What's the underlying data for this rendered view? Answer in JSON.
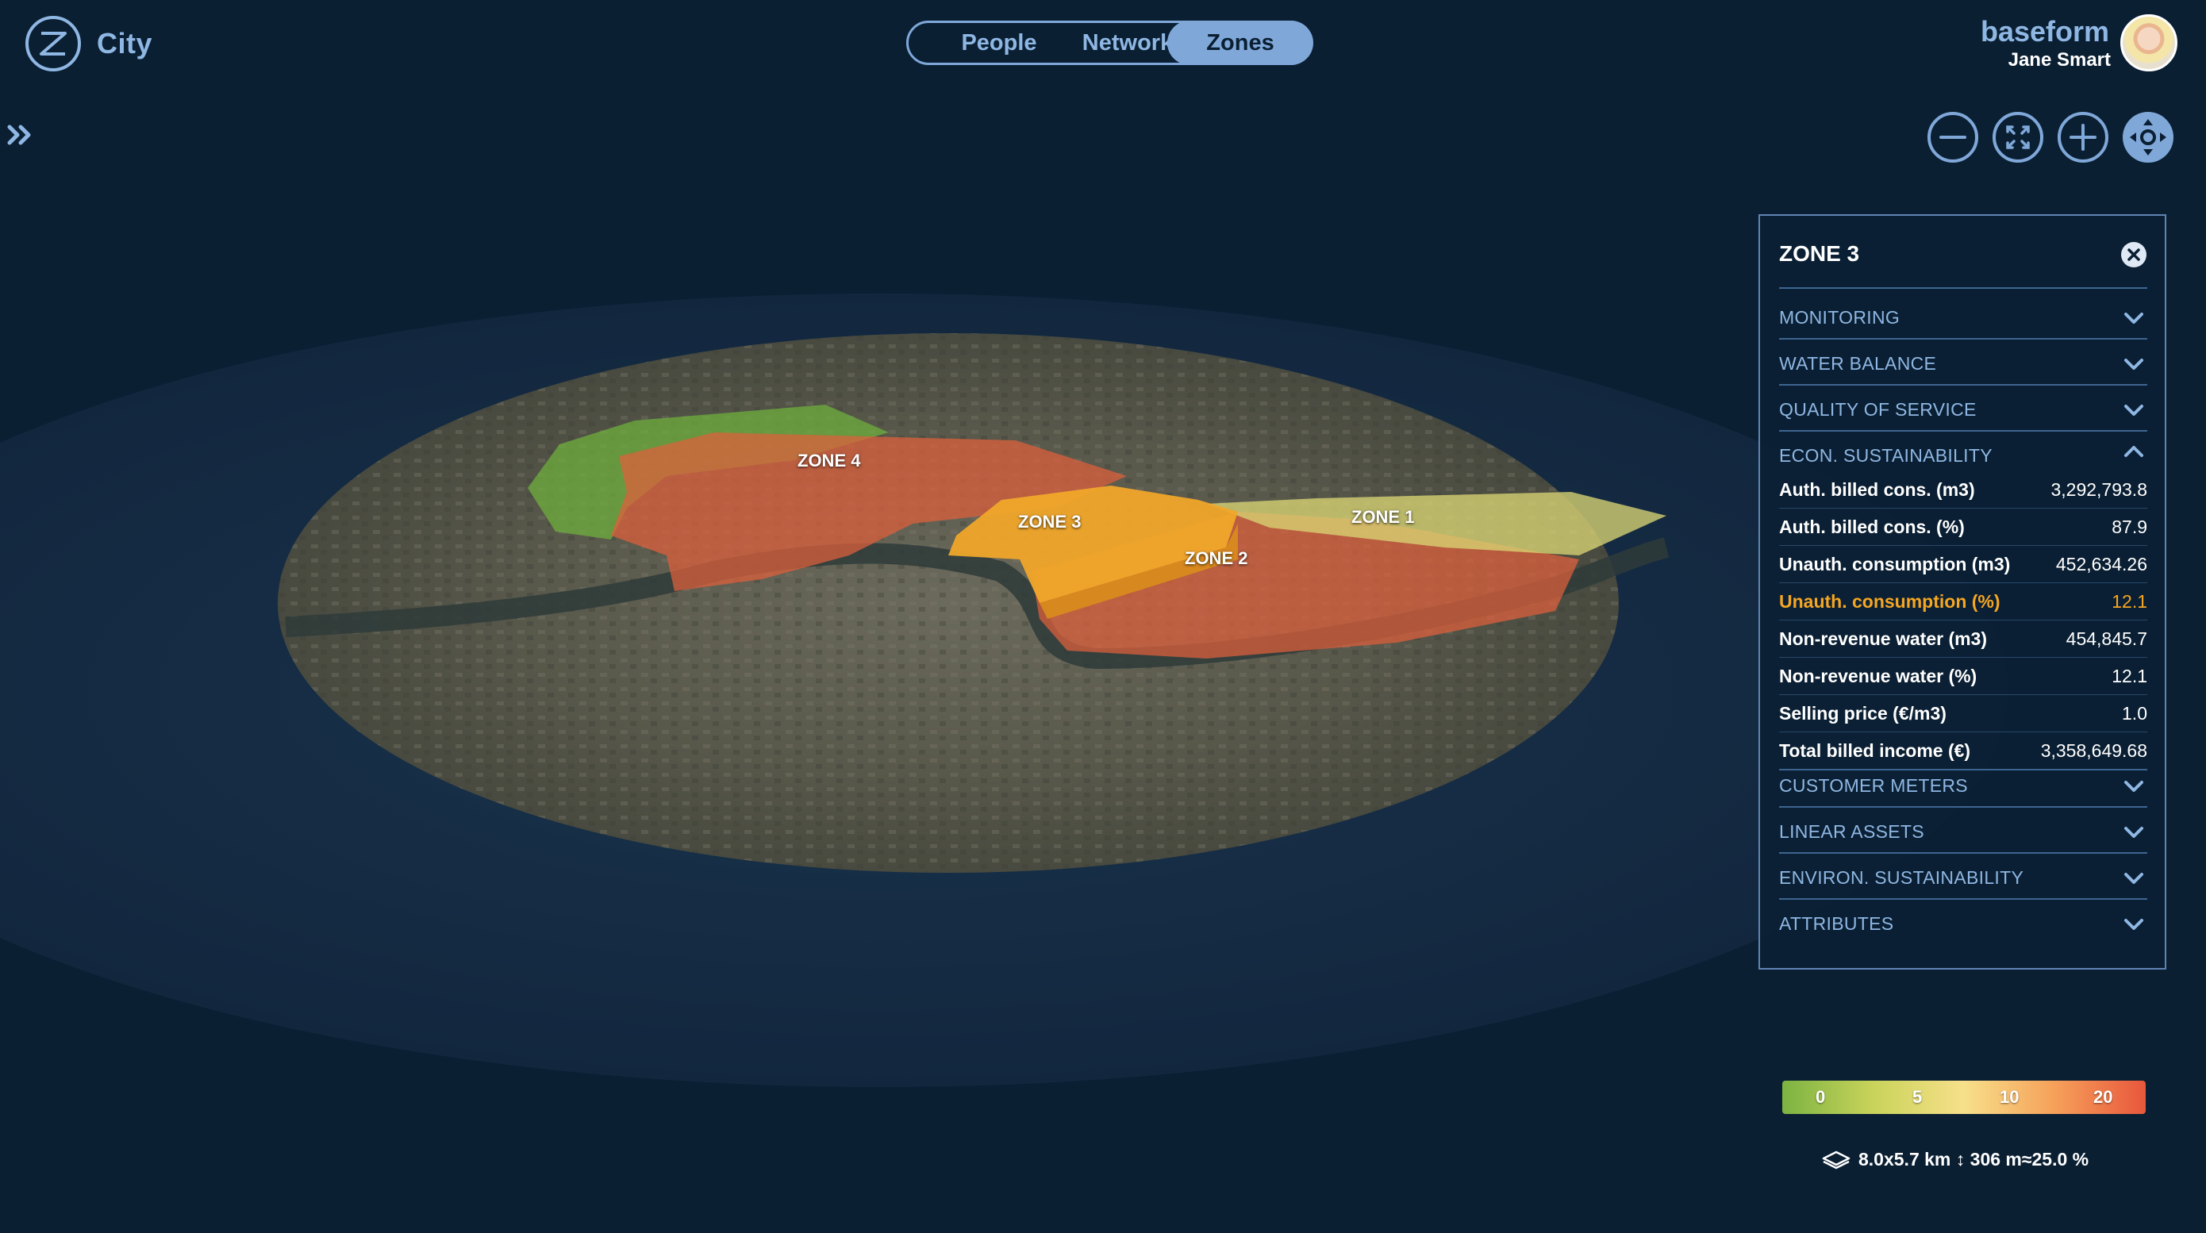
{
  "app": {
    "title": "City"
  },
  "tabs": [
    {
      "label": "People",
      "active": false
    },
    {
      "label": "Network",
      "active": false
    },
    {
      "label": "Zones",
      "active": true
    }
  ],
  "user": {
    "brand": "baseform",
    "name": "Jane Smart"
  },
  "controls": [
    "zoom-out",
    "fit-to-screen",
    "zoom-in",
    "pan"
  ],
  "map": {
    "zones": [
      {
        "label": "ZONE 4"
      },
      {
        "label": "ZONE 3"
      },
      {
        "label": "ZONE 2"
      },
      {
        "label": "ZONE 1"
      }
    ]
  },
  "panel": {
    "title": "ZONE 3",
    "sections_before": [
      {
        "label": "MONITORING",
        "expanded": false
      },
      {
        "label": "WATER BALANCE",
        "expanded": false
      },
      {
        "label": "QUALITY OF SERVICE",
        "expanded": false
      }
    ],
    "econ": {
      "label": "ECON. SUSTAINABILITY",
      "expanded": true,
      "rows": [
        {
          "key": "Auth. billed cons. (m3)",
          "value": "3,292,793.8"
        },
        {
          "key": "Auth. billed cons. (%)",
          "value": "87.9"
        },
        {
          "key": "Unauth. consumption (m3)",
          "value": "452,634.26"
        },
        {
          "key": "Unauth. consumption (%)",
          "value": "12.1",
          "highlight": true
        },
        {
          "key": "Non-revenue water (m3)",
          "value": "454,845.7"
        },
        {
          "key": "Non-revenue water (%)",
          "value": "12.1"
        },
        {
          "key": "Selling price (€/m3)",
          "value": "1.0"
        },
        {
          "key": "Total billed income (€)",
          "value": "3,358,649.68"
        }
      ]
    },
    "sections_after": [
      {
        "label": "CUSTOMER METERS",
        "expanded": false
      },
      {
        "label": "LINEAR ASSETS",
        "expanded": false
      },
      {
        "label": "ENVIRON. SUSTAINABILITY",
        "expanded": false
      },
      {
        "label": "ATTRIBUTES",
        "expanded": false
      }
    ]
  },
  "legend": {
    "ticks": [
      "0",
      "5",
      "10",
      "20"
    ]
  },
  "scale": {
    "text": "8.0x5.7 km ↕ 306 m≈25.0 %"
  },
  "colors": {
    "accent": "#7fa8d9",
    "highlight": "#f5a623",
    "background": "#0b1f33"
  }
}
